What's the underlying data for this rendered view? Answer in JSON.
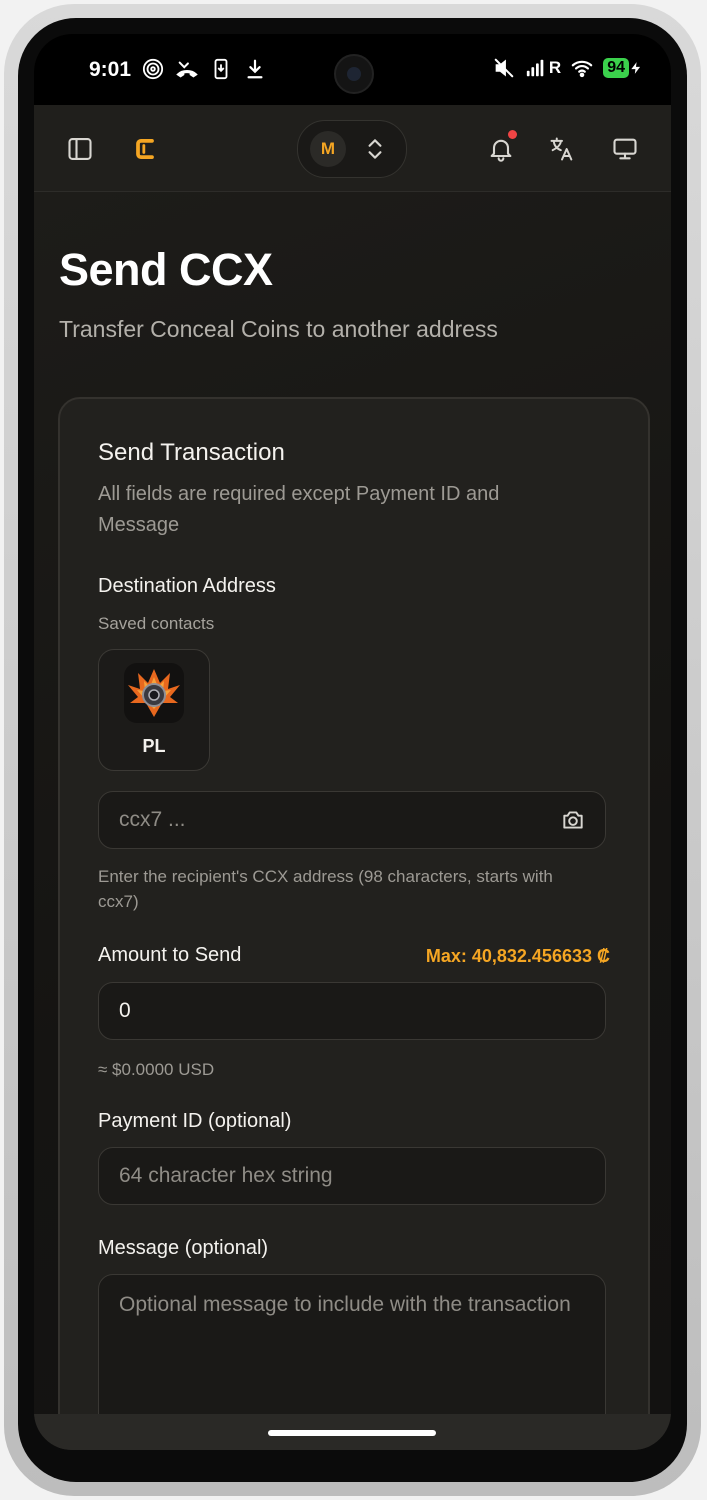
{
  "status_bar": {
    "time": "9:01",
    "signal_label": "R",
    "battery": "94",
    "icons_left": [
      "hotspot-icon",
      "missed-call-icon",
      "phone-update-icon",
      "download-icon"
    ],
    "icons_right": [
      "mute-icon",
      "signal-icon",
      "wifi-icon",
      "charging-icon"
    ]
  },
  "header": {
    "icons": [
      "sidebar-toggle-icon",
      "logo-icon",
      "bell-icon",
      "translate-icon",
      "monitor-icon"
    ],
    "account_initial": "M",
    "brand_color": "#f5a623",
    "notification_color": "#ef4444"
  },
  "page": {
    "title": "Send CCX",
    "subtitle": "Transfer Conceal Coins to another address"
  },
  "form": {
    "title": "Send Transaction",
    "description": "All fields are required except Payment ID and Message",
    "destination": {
      "label": "Destination Address",
      "saved_contacts_label": "Saved contacts",
      "contacts": [
        {
          "name": "PL"
        }
      ],
      "placeholder": "ccx7 ...",
      "value": "",
      "help": "Enter the recipient's CCX address (98 characters, starts with ccx7)"
    },
    "amount": {
      "label": "Amount to Send",
      "max": "Max: 40,832.456633 ₡",
      "value": "0",
      "usd_estimate": "≈ $0.0000 USD"
    },
    "payment_id": {
      "label": "Payment ID (optional)",
      "placeholder": "64 character hex string",
      "value": ""
    },
    "message": {
      "label": "Message (optional)",
      "placeholder": "Optional message to include with the transaction",
      "value": ""
    }
  }
}
